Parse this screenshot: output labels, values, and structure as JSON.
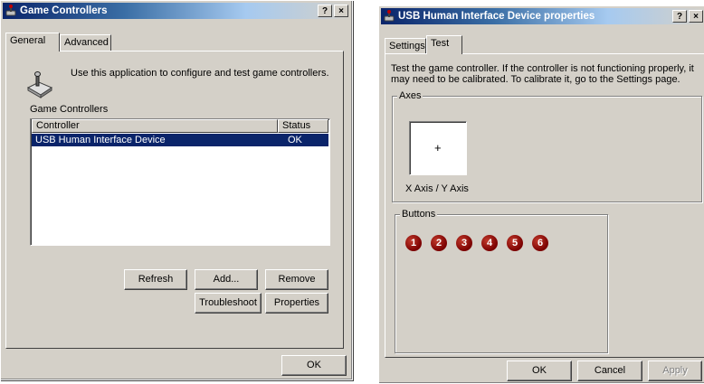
{
  "left_window": {
    "title": "Game Controllers",
    "title_buttons": {
      "help": "?",
      "close": "×"
    },
    "tabs": [
      {
        "label": "General"
      },
      {
        "label": "Advanced"
      }
    ],
    "description": "Use this application to configure and test game controllers.",
    "section_label": "Game Controllers",
    "columns": {
      "controller": "Controller",
      "status": "Status"
    },
    "rows": [
      {
        "controller": "USB Human Interface Device",
        "status": "OK"
      }
    ],
    "buttons": {
      "refresh": "Refresh",
      "add": "Add...",
      "remove": "Remove",
      "troubleshoot": "Troubleshoot",
      "properties": "Properties",
      "ok": "OK"
    }
  },
  "right_window": {
    "title": "USB Human Interface Device properties",
    "title_buttons": {
      "help": "?",
      "close": "×"
    },
    "tabs": [
      {
        "label": "Settings"
      },
      {
        "label": "Test"
      }
    ],
    "instructions": "Test the game controller.  If the controller is not functioning properly, it may need to be calibrated.  To calibrate it, go to the Settings page.",
    "axes": {
      "label": "Axes",
      "crosshair": "+",
      "axis_label": "X Axis / Y Axis"
    },
    "buttons_group": {
      "label": "Buttons",
      "items": [
        "1",
        "2",
        "3",
        "4",
        "5",
        "6"
      ]
    },
    "footer": {
      "ok": "OK",
      "cancel": "Cancel",
      "apply": "Apply"
    }
  },
  "colors": {
    "titlebar_start": "#0a246a",
    "selection": "#0a246a",
    "face": "#d4d0c8",
    "joystick_button": "#a00000"
  }
}
